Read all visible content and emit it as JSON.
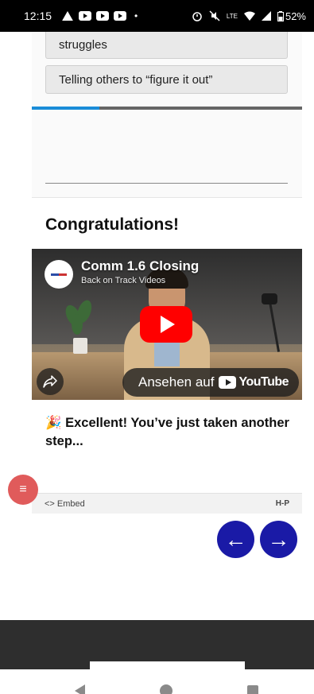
{
  "status_bar": {
    "time": "12:15",
    "dot": "•",
    "battery": "52%",
    "network": "LTE"
  },
  "quiz": {
    "answers": [
      {
        "label": "struggles"
      },
      {
        "label": "Telling others to “figure it out”"
      }
    ],
    "progress_fraction": 0.25
  },
  "summary": {
    "heading": "Congratulations!",
    "video": {
      "title": "Comm 1.6 Closing",
      "channel": "Back on Track Videos",
      "watch_label": "Ansehen auf",
      "youtube_wordmark": "YouTube"
    },
    "message": "🎉 Excellent! You’ve just taken another step..."
  },
  "h5p_bar": {
    "embed_label": "<> Embed",
    "brand": "H-P"
  },
  "navigation": {
    "prev_symbol": "←",
    "next_symbol": "→",
    "list_symbol": "≡"
  },
  "colors": {
    "accent_progress": "#1a8cd8",
    "nav_button": "#1a1aa6",
    "list_fab": "#e05b5b",
    "youtube_red": "#ff0000"
  }
}
